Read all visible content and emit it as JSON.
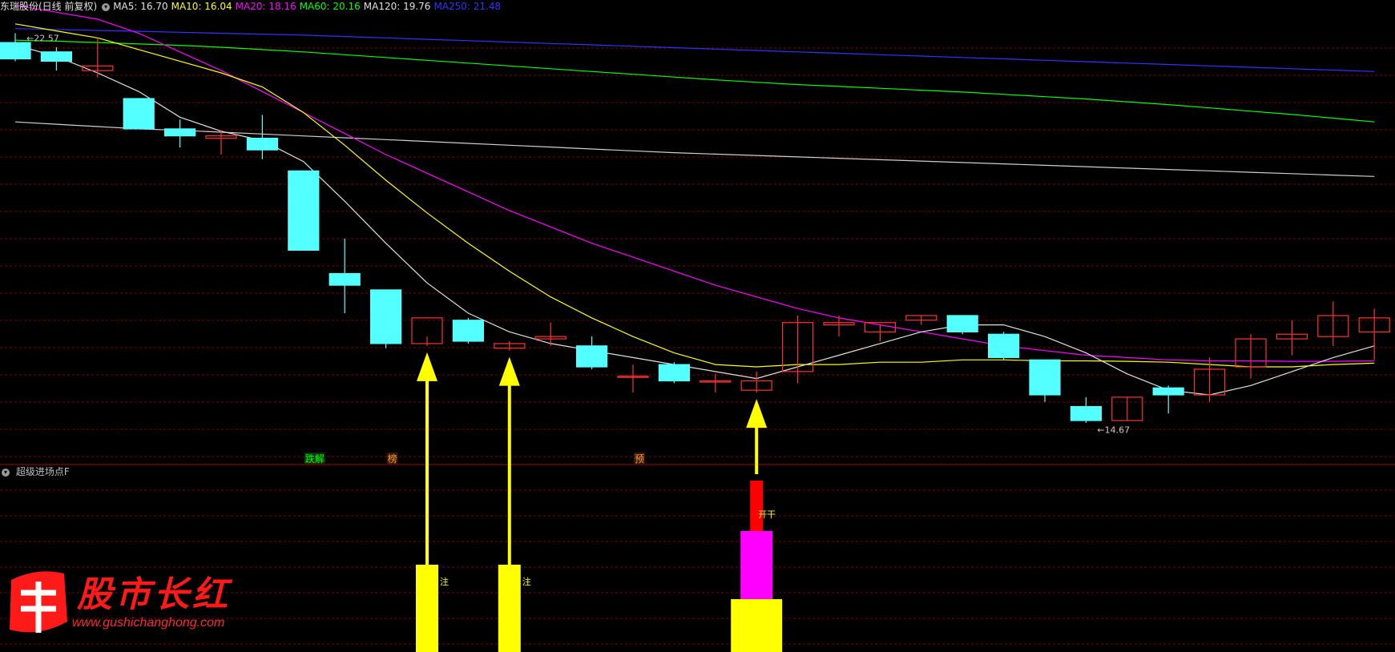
{
  "header": {
    "stock_title": "东瑞股份(日线 前复权)",
    "ma_labels": [
      {
        "text": "MA5: 16.70",
        "color": "#e0e0e0"
      },
      {
        "text": "MA10: 16.04",
        "color": "#ffff00"
      },
      {
        "text": "MA20: 18.16",
        "color": "#ff00ff"
      },
      {
        "text": "MA60: 20.16",
        "color": "#00ff00"
      },
      {
        "text": "MA120: 19.76",
        "color": "#e0e0e0"
      },
      {
        "text": "MA250: 21.48",
        "color": "#3333ff"
      }
    ]
  },
  "sub_panel": {
    "title": "超级进场点F"
  },
  "logo": {
    "brand": "股市长红",
    "url": "www.gushichanghong.com"
  },
  "colors": {
    "up": "#ff3232",
    "down": "#54ffff",
    "ma5": "#e0e0e0",
    "ma10": "#ffff00",
    "ma20": "#ff00ff",
    "ma60": "#00ff00",
    "ma120": "#cfcfcf",
    "ma250": "#3333ff",
    "grid": "#7a0000",
    "arrow": "#ffff00",
    "bar_yellow": "#ffff00",
    "bar_magenta": "#ff00ff",
    "bar_red": "#ff0000"
  },
  "chart_data": {
    "type": "candlestick",
    "price_range": [
      14.1,
      23.3
    ],
    "candles": [
      {
        "o": 22.8,
        "h": 23.0,
        "l": 22.4,
        "c": 22.45
      },
      {
        "o": 22.6,
        "h": 22.7,
        "l": 22.2,
        "c": 22.4
      },
      {
        "o": 22.2,
        "h": 22.9,
        "l": 22.05,
        "c": 22.3
      },
      {
        "o": 21.6,
        "h": 21.6,
        "l": 20.95,
        "c": 20.95
      },
      {
        "o": 20.95,
        "h": 21.15,
        "l": 20.55,
        "c": 20.8
      },
      {
        "o": 20.75,
        "h": 20.9,
        "l": 20.4,
        "c": 20.8
      },
      {
        "o": 20.75,
        "h": 21.25,
        "l": 20.3,
        "c": 20.5
      },
      {
        "o": 20.05,
        "h": 20.05,
        "l": 18.35,
        "c": 18.35
      },
      {
        "o": 17.85,
        "h": 18.6,
        "l": 17.0,
        "c": 17.6
      },
      {
        "o": 17.5,
        "h": 17.5,
        "l": 16.25,
        "c": 16.35
      },
      {
        "o": 16.35,
        "h": 16.5,
        "l": 16.3,
        "c": 16.9
      },
      {
        "o": 16.85,
        "h": 16.9,
        "l": 16.35,
        "c": 16.4
      },
      {
        "o": 16.25,
        "h": 16.4,
        "l": 16.2,
        "c": 16.35
      },
      {
        "o": 16.45,
        "h": 16.8,
        "l": 16.3,
        "c": 16.5
      },
      {
        "o": 16.3,
        "h": 16.5,
        "l": 15.8,
        "c": 15.85
      },
      {
        "o": 15.65,
        "h": 15.9,
        "l": 15.3,
        "c": 15.65
      },
      {
        "o": 15.9,
        "h": 15.95,
        "l": 15.5,
        "c": 15.55
      },
      {
        "o": 15.55,
        "h": 15.7,
        "l": 15.3,
        "c": 15.55
      },
      {
        "o": 15.35,
        "h": 15.75,
        "l": 15.3,
        "c": 15.55
      },
      {
        "o": 15.75,
        "h": 16.95,
        "l": 15.5,
        "c": 16.8
      },
      {
        "o": 16.75,
        "h": 16.95,
        "l": 16.5,
        "c": 16.8
      },
      {
        "o": 16.6,
        "h": 16.75,
        "l": 16.4,
        "c": 16.8
      },
      {
        "o": 16.85,
        "h": 16.95,
        "l": 16.75,
        "c": 16.95
      },
      {
        "o": 16.95,
        "h": 16.95,
        "l": 16.55,
        "c": 16.6
      },
      {
        "o": 16.55,
        "h": 16.6,
        "l": 16.0,
        "c": 16.05
      },
      {
        "o": 16.0,
        "h": 16.0,
        "l": 15.1,
        "c": 15.25
      },
      {
        "o": 15.0,
        "h": 15.2,
        "l": 14.65,
        "c": 14.7
      },
      {
        "o": 14.7,
        "h": 15.2,
        "l": 14.7,
        "c": 15.2
      },
      {
        "o": 15.4,
        "h": 15.45,
        "l": 14.85,
        "c": 15.25
      },
      {
        "o": 15.25,
        "h": 16.05,
        "l": 15.1,
        "c": 15.8
      },
      {
        "o": 15.85,
        "h": 16.55,
        "l": 15.6,
        "c": 16.45
      },
      {
        "o": 16.45,
        "h": 16.85,
        "l": 16.1,
        "c": 16.55
      },
      {
        "o": 16.5,
        "h": 17.25,
        "l": 16.3,
        "c": 16.95
      },
      {
        "o": 16.6,
        "h": 17.1,
        "l": 16.0,
        "c": 16.9
      }
    ],
    "ma5": [
      22.75,
      22.5,
      22.15,
      21.75,
      21.2,
      20.9,
      20.7,
      20.25,
      19.4,
      18.5,
      17.65,
      17.0,
      16.6,
      16.35,
      16.2,
      16.05,
      15.9,
      15.75,
      15.6,
      15.85,
      16.1,
      16.35,
      16.6,
      16.75,
      16.75,
      16.5,
      16.15,
      15.7,
      15.35,
      15.25,
      15.45,
      15.75,
      16.05,
      16.3
    ],
    "ma10": [
      23.2,
      23.05,
      22.9,
      22.65,
      22.4,
      22.15,
      21.85,
      21.3,
      20.6,
      19.85,
      19.15,
      18.5,
      17.9,
      17.35,
      16.9,
      16.5,
      16.15,
      15.9,
      15.85,
      15.9,
      15.9,
      15.95,
      15.95,
      16.0,
      16.0,
      15.98,
      15.98,
      15.97,
      15.95,
      15.9,
      15.85,
      15.85,
      15.9,
      15.93
    ],
    "ma20": [
      23.6,
      23.45,
      23.3,
      23.0,
      22.6,
      22.2,
      21.75,
      21.3,
      20.85,
      20.4,
      20.0,
      19.6,
      19.2,
      18.85,
      18.5,
      18.2,
      17.9,
      17.6,
      17.35,
      17.1,
      16.9,
      16.75,
      16.6,
      16.45,
      16.3,
      16.2,
      16.1,
      16.05,
      16.0,
      15.98,
      15.98,
      15.97,
      15.97,
      15.98
    ],
    "ma60": [
      22.85,
      22.83,
      22.8,
      22.77,
      22.74,
      22.7,
      22.65,
      22.6,
      22.54,
      22.48,
      22.42,
      22.36,
      22.3,
      22.24,
      22.18,
      22.12,
      22.06,
      22.0,
      21.95,
      21.9,
      21.86,
      21.82,
      21.78,
      21.74,
      21.69,
      21.64,
      21.59,
      21.53,
      21.47,
      21.4,
      21.33,
      21.26,
      21.18,
      21.1
    ],
    "ma120": [
      21.1,
      21.05,
      21.0,
      20.95,
      20.92,
      20.88,
      20.84,
      20.8,
      20.76,
      20.72,
      20.68,
      20.64,
      20.6,
      20.56,
      20.52,
      20.48,
      20.44,
      20.41,
      20.38,
      20.35,
      20.32,
      20.29,
      20.26,
      20.23,
      20.2,
      20.17,
      20.14,
      20.11,
      20.08,
      20.05,
      20.02,
      19.99,
      19.96,
      19.93
    ],
    "ma250": [
      23.1,
      23.08,
      23.06,
      23.04,
      23.02,
      23.0,
      22.98,
      22.96,
      22.93,
      22.9,
      22.87,
      22.84,
      22.81,
      22.78,
      22.75,
      22.72,
      22.69,
      22.66,
      22.63,
      22.6,
      22.57,
      22.54,
      22.51,
      22.48,
      22.45,
      22.42,
      22.39,
      22.36,
      22.33,
      22.3,
      22.27,
      22.24,
      22.21,
      22.18
    ],
    "price_labels": [
      {
        "index": 0,
        "text": "22.57",
        "price": 22.9
      },
      {
        "index": 26,
        "text": "14.67",
        "price": 14.5
      }
    ],
    "signal_labels": [
      {
        "index": 7,
        "text": "跌解",
        "color": "#00ff00",
        "bg": "#083308"
      },
      {
        "index": 9,
        "text": "榜",
        "color": "#ff9933",
        "bg": "#331a00"
      },
      {
        "index": 15,
        "text": "预",
        "color": "#ff9933",
        "bg": "#331a00"
      }
    ],
    "arrows": [
      10,
      12,
      18
    ],
    "sub_bars": [
      {
        "index": 10,
        "kind": "yellow_tall",
        "label": "注"
      },
      {
        "index": 12,
        "kind": "yellow_tall",
        "label": "注"
      },
      {
        "index": 18,
        "kind": "stack",
        "label": "开干"
      }
    ]
  }
}
